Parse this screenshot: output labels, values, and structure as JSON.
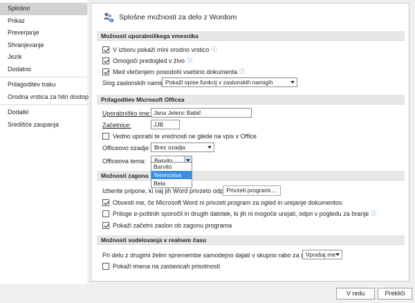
{
  "sidebar": {
    "items": [
      {
        "label": "Splošno",
        "active": true
      },
      {
        "label": "Prikaz"
      },
      {
        "label": "Preverjanje"
      },
      {
        "label": "Shranjevanje"
      },
      {
        "label": "Jezik"
      },
      {
        "label": "Dodatno"
      },
      {
        "label": "Prilagoditev traku"
      },
      {
        "label": "Orodna vrstica za hitri dostop"
      },
      {
        "label": "Dodatki"
      },
      {
        "label": "Središče zaupanja"
      }
    ]
  },
  "header": {
    "title": "Splošne možnosti za delo z Wordom",
    "icon": "people-settings-icon"
  },
  "ui_options": {
    "section_title": "Možnosti uporabniškega vmesnika",
    "show_mini_toolbar": {
      "label": "V izboru pokaži mini orodno vrstico",
      "checked": true
    },
    "live_preview": {
      "label": "Omogoči predogled v živo",
      "checked": true
    },
    "update_content": {
      "label": "Med vlečenjem posodobi vsebino dokumenta",
      "checked": true
    },
    "tooltip_style": {
      "label": "Slog zaslonskih namigov:",
      "value": "Pokaži opise funkcij v zaslonskih namigih"
    }
  },
  "personalize": {
    "section_title": "Prilagoditev Microsoft Officea",
    "username": {
      "label": "Uporabniško ime:",
      "value": "Jana Jelenc Babič"
    },
    "initials": {
      "label": "Začetnice:",
      "value": "JJB"
    },
    "always_use": {
      "label": "Vedno uporabi te vrednosti ne glede na vpis v Office",
      "checked": false
    },
    "background": {
      "label": "Officeovo ozadje:",
      "value": "Brez ozadja"
    },
    "theme": {
      "label": "Officeova tema:",
      "value": "Barvito",
      "options": [
        "Barvito",
        "Temnosiva",
        "Bela"
      ],
      "highlighted": "Temnosiva"
    }
  },
  "startup": {
    "section_title": "Možnosti zagona",
    "choose_ext_label": "Izberite pripone, ki naj jih Word privzeto odpre:",
    "default_programs_button": "Privzeti programi ...",
    "notify_default": {
      "label": "Obvesti me, če Microsoft Word ni privzeti program za ogled in urejanje dokumentov.",
      "checked": true
    },
    "open_attachments": {
      "label": "Priloge e-poštnih sporočil in drugih datotek, ki jih ni mogoče urejati, odpri v pogledu za branje",
      "checked": false
    },
    "show_start_screen": {
      "label": "Pokaži začetni zaslon ob zagonu programa",
      "checked": true
    }
  },
  "collab": {
    "section_title": "Možnosti sodelovanja v realnem času",
    "share_label": "Pri delu z drugimi želim spremembe samodejno dajati v skupno rabo za druge:",
    "share_value": "Vprašaj me",
    "show_names": {
      "label": "Pokaži imena na zastavicah prisotnosti",
      "checked": false
    }
  },
  "footer": {
    "ok": "V redu",
    "cancel": "Prekliči"
  },
  "glyphs": {
    "info": "ⓘ"
  }
}
